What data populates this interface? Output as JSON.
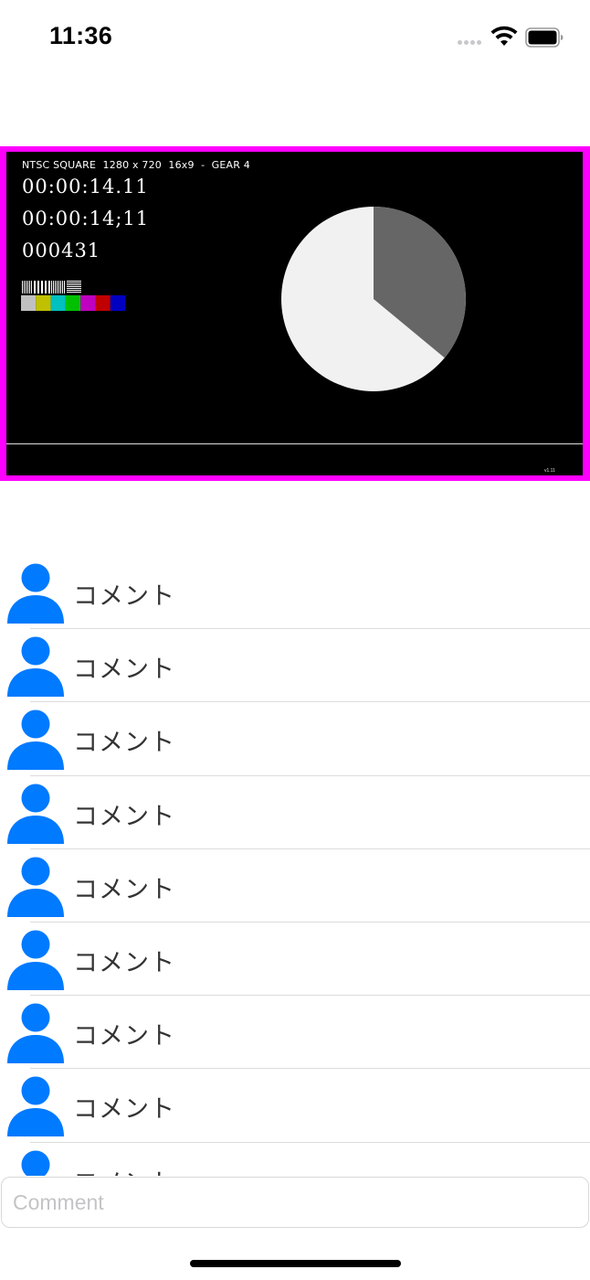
{
  "status_bar": {
    "time": "11:36",
    "icons": [
      "cellular-signal-icon",
      "wifi-icon",
      "battery-icon"
    ]
  },
  "video": {
    "info_line": "NTSC SQUARE  1280 x 720  16x9  -  GEAR 4",
    "timecode_1": "00:00:14.11",
    "timecode_2": "00:00:14;11",
    "frame_counter": "000431",
    "corner_text": "v1.11",
    "border_color": "#ff00ff",
    "pie_progress_fraction": 0.36,
    "color_bars": [
      "#c0c0c0",
      "#c0c000",
      "#00c0c0",
      "#00c000",
      "#c000c0",
      "#c00000",
      "#0000c0"
    ]
  },
  "comments": [
    {
      "text": "コメント",
      "avatar_icon": "person-icon"
    },
    {
      "text": "コメント",
      "avatar_icon": "person-icon"
    },
    {
      "text": "コメント",
      "avatar_icon": "person-icon"
    },
    {
      "text": "コメント",
      "avatar_icon": "person-icon"
    },
    {
      "text": "コメント",
      "avatar_icon": "person-icon"
    },
    {
      "text": "コメント",
      "avatar_icon": "person-icon"
    },
    {
      "text": "コメント",
      "avatar_icon": "person-icon"
    },
    {
      "text": "コメント",
      "avatar_icon": "person-icon"
    },
    {
      "text": "コメント",
      "avatar_icon": "person-icon"
    }
  ],
  "input": {
    "placeholder": "Comment",
    "value": ""
  },
  "colors": {
    "accent": "#007aff"
  }
}
